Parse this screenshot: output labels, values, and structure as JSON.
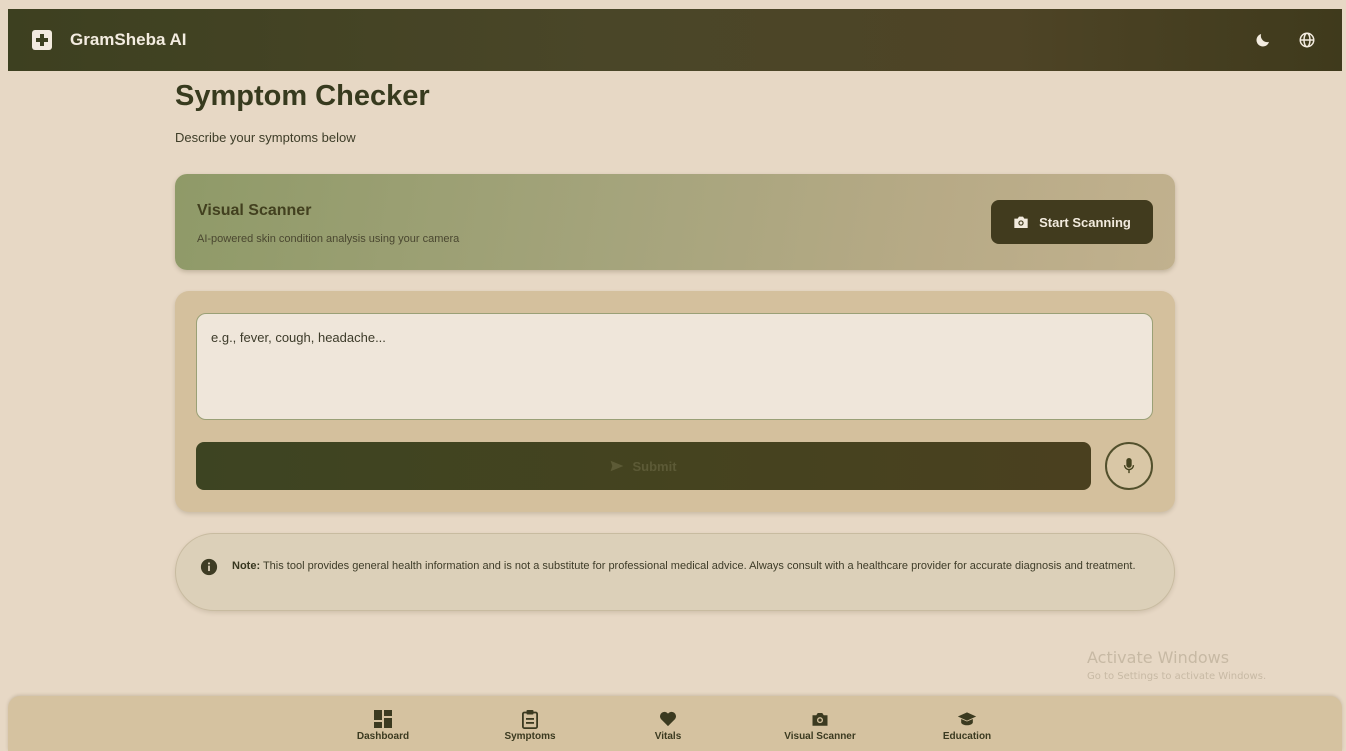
{
  "header": {
    "brand": "GramSheba AI",
    "icons": {
      "brand": "medical-cross-icon",
      "theme": "moon-icon",
      "language": "globe-icon"
    }
  },
  "page": {
    "title": "Symptom Checker",
    "subtitle": "Describe your symptoms below"
  },
  "scanner": {
    "title": "Visual Scanner",
    "description": "AI-powered skin condition analysis using your camera",
    "button_label": "Start Scanning",
    "button_icon": "camera-icon"
  },
  "symptoms": {
    "placeholder": "e.g., fever, cough, headache...",
    "value": "",
    "submit_label": "Submit",
    "submit_icon": "send-icon",
    "mic_icon": "microphone-icon"
  },
  "note": {
    "label": "Note:",
    "text": " This tool provides general health information and is not a substitute for professional medical advice. Always consult with a healthcare provider for accurate diagnosis and treatment.",
    "icon": "info-icon"
  },
  "watermark": {
    "title": "Activate Windows",
    "subtitle": "Go to Settings to activate Windows."
  },
  "bottom_nav": {
    "items": [
      {
        "label": "Dashboard",
        "icon": "dashboard-icon"
      },
      {
        "label": "Symptoms",
        "icon": "clipboard-icon"
      },
      {
        "label": "Vitals",
        "icon": "heart-icon"
      },
      {
        "label": "Visual Scanner",
        "icon": "camera-icon"
      },
      {
        "label": "Education",
        "icon": "graduation-cap-icon"
      }
    ]
  },
  "colors": {
    "background": "#e7d8c5",
    "header": "#3d4020",
    "accent_dark": "#413b1e",
    "card": "#d4c09d"
  }
}
